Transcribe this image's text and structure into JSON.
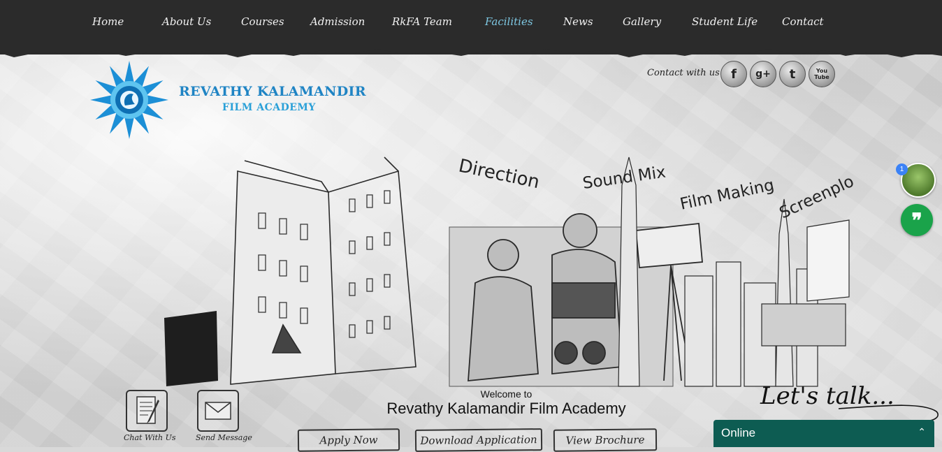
{
  "nav": {
    "items": [
      {
        "label": "Home"
      },
      {
        "label": "About Us"
      },
      {
        "label": "Courses"
      },
      {
        "label": "Admission"
      },
      {
        "label": "RkFA Team"
      },
      {
        "label": "Facilities"
      },
      {
        "label": "News"
      },
      {
        "label": "Gallery"
      },
      {
        "label": "Student Life"
      },
      {
        "label": "Contact"
      }
    ],
    "active_index": 5,
    "active_color": "#7ec8e3"
  },
  "brand": {
    "line1": "REVATHY KALAMANDIR",
    "line2": "FILM ACADEMY",
    "color": "#1f84c4"
  },
  "social": {
    "label": "Contact with us",
    "icons": [
      {
        "name": "facebook-icon",
        "glyph": "f"
      },
      {
        "name": "google-plus-icon",
        "glyph": "g+"
      },
      {
        "name": "twitter-icon",
        "glyph": "t"
      },
      {
        "name": "youtube-icon",
        "glyph": "You Tube"
      }
    ]
  },
  "hero": {
    "labels": [
      "Direction",
      "Sound Mix",
      "Film Making",
      "Screenplo"
    ]
  },
  "welcome": {
    "small": "Welcome to",
    "big": "Revathy Kalamandir Film Academy"
  },
  "actions": {
    "apply": "Apply Now",
    "download": "Download Application",
    "brochure": "View Brochure"
  },
  "quick": {
    "chat": "Chat With Us",
    "message": "Send Message"
  },
  "chat_widget": {
    "title": "Let's talk...",
    "status": "Online",
    "chevron": "⌃",
    "badge": "1",
    "quote_glyph": "❞",
    "color": "#0d5c52"
  }
}
